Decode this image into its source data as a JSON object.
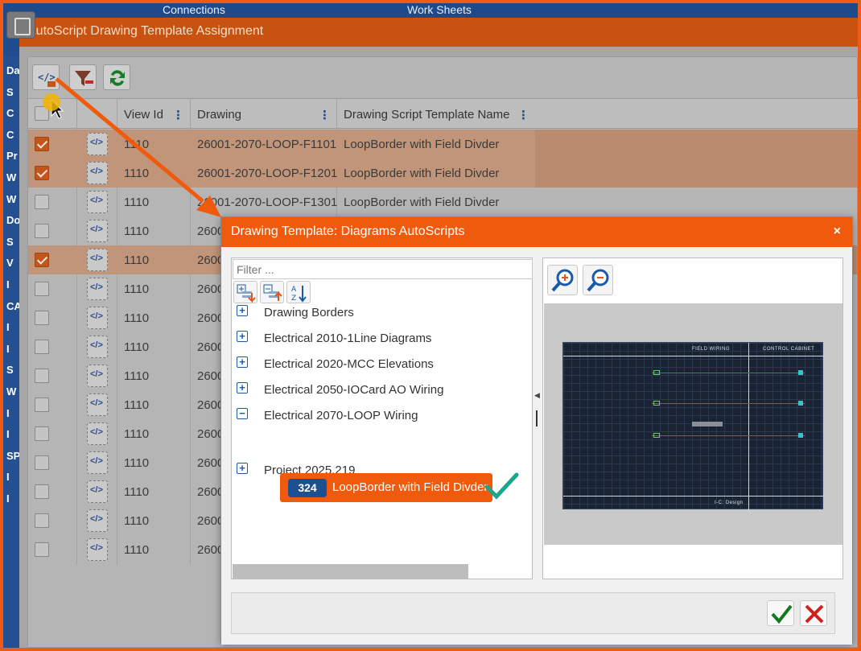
{
  "topbar": {
    "connections": "Connections",
    "worksheets": "Work Sheets"
  },
  "leftnav": {
    "items": [
      "Da",
      "S",
      "C",
      "C",
      "Pr",
      "W",
      "W",
      "Do",
      "S",
      "V",
      "I",
      "CA",
      "I",
      "I",
      "S",
      "W",
      "I",
      "I",
      "SP",
      "I",
      "I"
    ]
  },
  "outer": {
    "title": "AutoScript Drawing Template Assignment",
    "columns": {
      "view_id": "View Id",
      "drawing": "Drawing",
      "template": "Drawing Script Template Name"
    },
    "rows": [
      {
        "checked": true,
        "view_id": "1110",
        "drawing": "26001-2070-LOOP-F1101",
        "template": "LoopBorder with Field Divder"
      },
      {
        "checked": true,
        "view_id": "1110",
        "drawing": "26001-2070-LOOP-F1201",
        "template": "LoopBorder with Field Divder"
      },
      {
        "checked": false,
        "view_id": "1110",
        "drawing": "26001-2070-LOOP-F1301",
        "template": "LoopBorder with Field Divder"
      },
      {
        "checked": false,
        "view_id": "1110",
        "drawing": "2600",
        "template": ""
      },
      {
        "checked": true,
        "view_id": "1110",
        "drawing": "2600",
        "template": ""
      },
      {
        "checked": false,
        "view_id": "1110",
        "drawing": "2600",
        "template": ""
      },
      {
        "checked": false,
        "view_id": "1110",
        "drawing": "2600",
        "template": ""
      },
      {
        "checked": false,
        "view_id": "1110",
        "drawing": "2600",
        "template": ""
      },
      {
        "checked": false,
        "view_id": "1110",
        "drawing": "2600",
        "template": ""
      },
      {
        "checked": false,
        "view_id": "1110",
        "drawing": "2600",
        "template": ""
      },
      {
        "checked": false,
        "view_id": "1110",
        "drawing": "2600",
        "template": ""
      },
      {
        "checked": false,
        "view_id": "1110",
        "drawing": "2600",
        "template": ""
      },
      {
        "checked": false,
        "view_id": "1110",
        "drawing": "2600",
        "template": ""
      },
      {
        "checked": false,
        "view_id": "1110",
        "drawing": "2600",
        "template": ""
      },
      {
        "checked": false,
        "view_id": "1110",
        "drawing": "2600",
        "template": ""
      }
    ]
  },
  "modal": {
    "title": "Drawing Template: Diagrams AutoScripts",
    "close": "×",
    "filter_placeholder": "Filter ...",
    "tree": [
      {
        "label": "Drawing Borders",
        "expanded": false
      },
      {
        "label": "Electrical 2010-1Line Diagrams",
        "expanded": false
      },
      {
        "label": "Electrical 2020-MCC Elevations",
        "expanded": false
      },
      {
        "label": "Electrical 2050-IOCard AO Wiring",
        "expanded": false
      },
      {
        "label": "Electrical 2070-LOOP Wiring",
        "expanded": true
      },
      {
        "label": "Project 2025.219",
        "expanded": false
      }
    ],
    "selected_item": {
      "id": "324",
      "label": "LoopBorder with Field Divder"
    },
    "preview": {
      "field_wiring": "FIELD WIRING",
      "control_cabinet": "CONTROL CABINET",
      "title_block": "I-C: Design"
    }
  },
  "colors": {
    "accent": "#f05a0c",
    "badge": "#1d4f91",
    "check": "#1aa68a"
  }
}
